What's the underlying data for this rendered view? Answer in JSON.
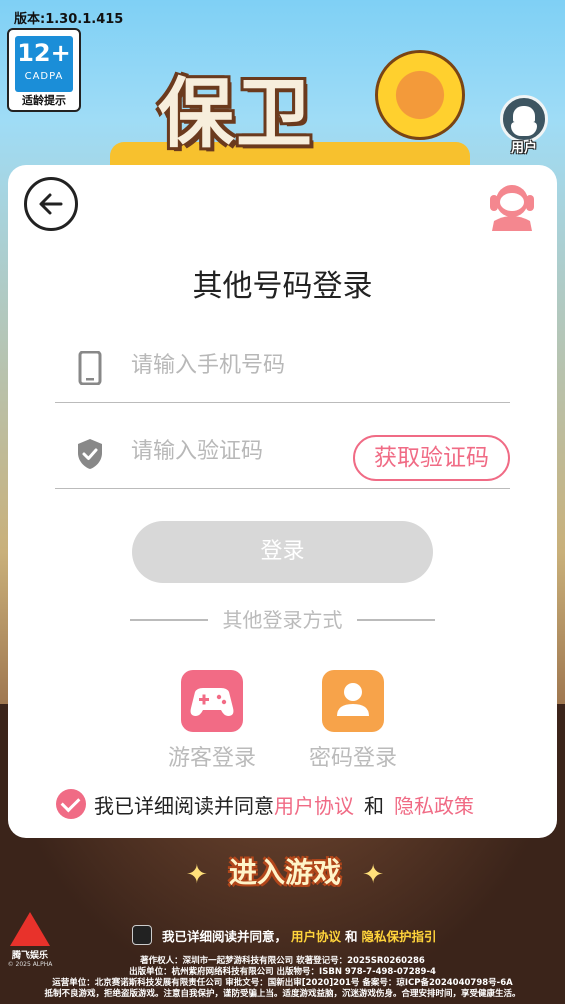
{
  "version": "版本:1.30.1.415",
  "age_badge": {
    "age": "12+",
    "org": "CADPA",
    "tip": "适龄提示"
  },
  "logo": {
    "title": "保卫"
  },
  "user_button": {
    "label": "用户"
  },
  "login": {
    "title": "其他号码登录",
    "phone_placeholder": "请输入手机号码",
    "code_placeholder": "请输入验证码",
    "get_code": "获取验证码",
    "login_button": "登录",
    "other_methods": "其他登录方式",
    "guest_login": "游客登录",
    "password_login": "密码登录",
    "agree_prefix": "我已详细阅读并同意",
    "user_agreement": "用户协议",
    "and": "和",
    "privacy_policy": "隐私政策"
  },
  "enter_game": "进入游戏",
  "company": {
    "name": "腾飞娱乐",
    "tagline": "© 2025 ALPHA"
  },
  "bottom": {
    "agree_prefix": "我已详细阅读并同意，",
    "user_agreement": "用户协议",
    "and": "和",
    "privacy_guide": "隐私保护指引",
    "legal_1": "著作权人：深圳市一起梦游科技有限公司  软著登记号：2025SR0260286",
    "legal_2": "出版单位：杭州紫府网络科技有限公司  出版物号：ISBN 978-7-498-07289-4",
    "legal_3": "运营单位：北京赛诺斯科技发展有限责任公司  审批文号：国新出审[2020]201号  备案号：琼ICP备2024040798号-6A",
    "legal_4": "抵制不良游戏，拒绝盗版游戏。注意自我保护，谨防受骗上当。适度游戏益脑，沉迷游戏伤身。合理安排时间，享受健康生活。"
  },
  "colors": {
    "accent": "#f06b85",
    "orange": "#f7a34a",
    "disabled": "#d8d8d8"
  }
}
